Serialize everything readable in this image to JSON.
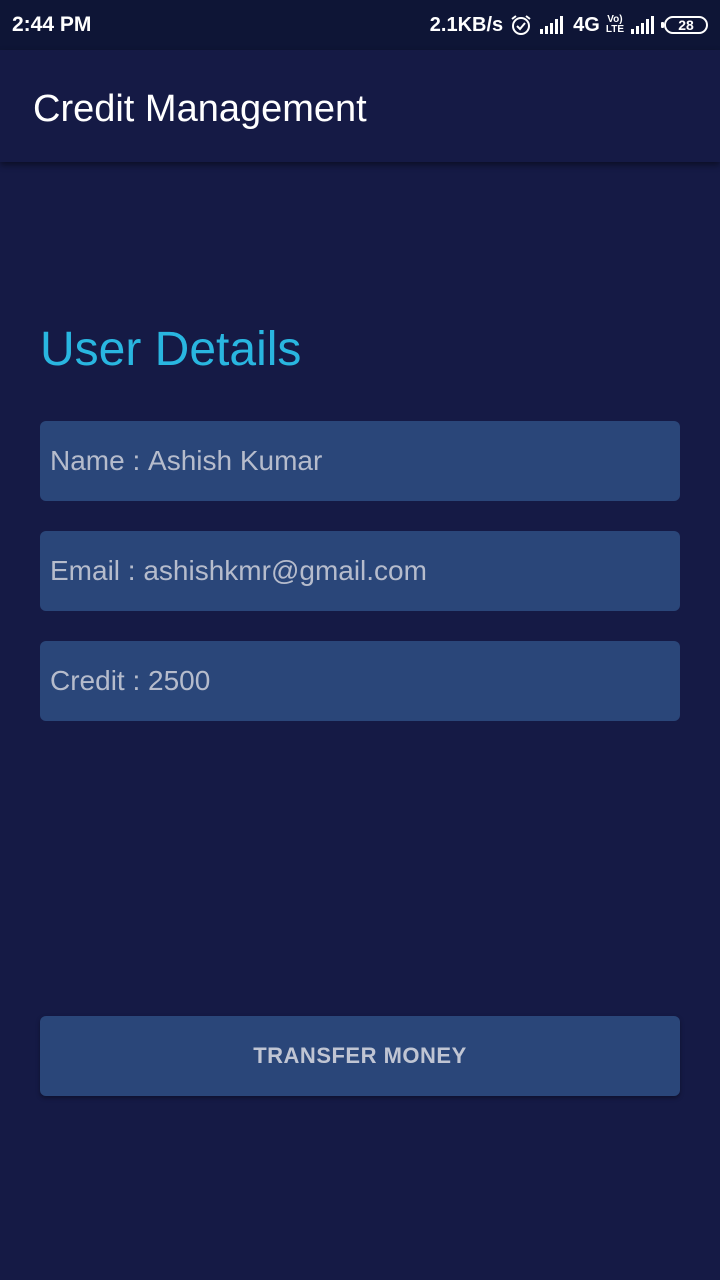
{
  "status_bar": {
    "time": "2:44 PM",
    "network_speed": "2.1KB/s",
    "alarm_icon": "alarm-icon",
    "signal_icon": "signal-icon",
    "network_type": "4G",
    "volte_line1": "Vo)",
    "volte_line2": "LTE",
    "battery_level": "28"
  },
  "app_bar": {
    "title": "Credit Management"
  },
  "user_details": {
    "heading": "User Details",
    "name_label": "Name : ",
    "name_value": "Ashish Kumar",
    "email_label": "Email : ",
    "email_value": "ashishkmr@gmail.com",
    "credit_label": "Credit : ",
    "credit_value": "2500"
  },
  "actions": {
    "transfer_label": "TRANSFER MONEY"
  },
  "colors": {
    "background": "#151a45",
    "status_bar": "#0e1536",
    "field": "#2a4679",
    "accent": "#29b6e0"
  }
}
